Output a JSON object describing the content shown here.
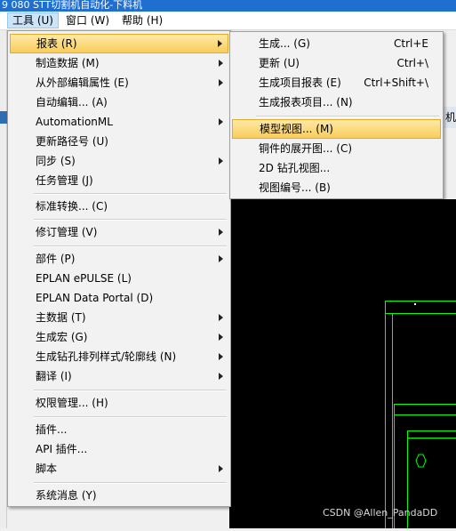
{
  "window": {
    "title": "9  080  STT切割机自动化-下料机"
  },
  "menubar": [
    {
      "label": "工具 (U)"
    },
    {
      "label": "窗口 (W)"
    },
    {
      "label": "帮助 (H)"
    }
  ],
  "background": {
    "strip_text": "机"
  },
  "tools_menu": {
    "items": [
      {
        "label": "报表 (R)",
        "submenu": true
      },
      {
        "label": "制造数据 (M)",
        "submenu": true
      },
      {
        "label": "从外部编辑属性 (E)",
        "submenu": true
      },
      {
        "label": "自动编辑... (A)",
        "submenu": false
      },
      {
        "label": "AutomationML",
        "submenu": true
      },
      {
        "label": "更新路径号 (U)",
        "submenu": false
      },
      {
        "label": "同步 (S)",
        "submenu": true
      },
      {
        "label": "任务管理 (J)",
        "submenu": false
      },
      {
        "label": "标准转换... (C)",
        "submenu": false
      },
      {
        "label": "修订管理 (V)",
        "submenu": true
      },
      {
        "label": "部件 (P)",
        "submenu": true
      },
      {
        "label": "EPLAN ePULSE (L)",
        "submenu": false
      },
      {
        "label": "EPLAN Data Portal (D)",
        "submenu": false
      },
      {
        "label": "主数据 (T)",
        "submenu": true
      },
      {
        "label": "生成宏 (G)",
        "submenu": true
      },
      {
        "label": "生成钻孔排列样式/轮廓线 (N)",
        "submenu": true
      },
      {
        "label": "翻译 (I)",
        "submenu": true
      },
      {
        "label": "权限管理... (H)",
        "submenu": false
      },
      {
        "label": "插件...",
        "submenu": false
      },
      {
        "label": "API 插件...",
        "submenu": false
      },
      {
        "label": "脚本",
        "submenu": true
      },
      {
        "label": "系统消息 (Y)",
        "submenu": false
      }
    ]
  },
  "reports_submenu": {
    "items": [
      {
        "label": "生成... (G)",
        "shortcut": "Ctrl+E"
      },
      {
        "label": "更新 (U)",
        "shortcut": "Ctrl+\\"
      },
      {
        "label": "生成项目报表 (E)",
        "shortcut": "Ctrl+Shift+\\"
      },
      {
        "label": "生成报表项目... (N)",
        "shortcut": ""
      },
      {
        "label": "模型视图... (M)",
        "shortcut": ""
      },
      {
        "label": "铜件的展开图... (C)",
        "shortcut": ""
      },
      {
        "label": "2D 钻孔视图...",
        "shortcut": ""
      },
      {
        "label": "视图编号... (B)",
        "shortcut": ""
      }
    ]
  },
  "watermark": "CSDN @Allen_PandaDD",
  "colors": {
    "title_bar": "#1e6fd0",
    "menu_bg": "#f2f2f2",
    "highlight": "#f9cd5a",
    "canvas_bg": "#000000",
    "cad_lines": "#00ff00"
  }
}
